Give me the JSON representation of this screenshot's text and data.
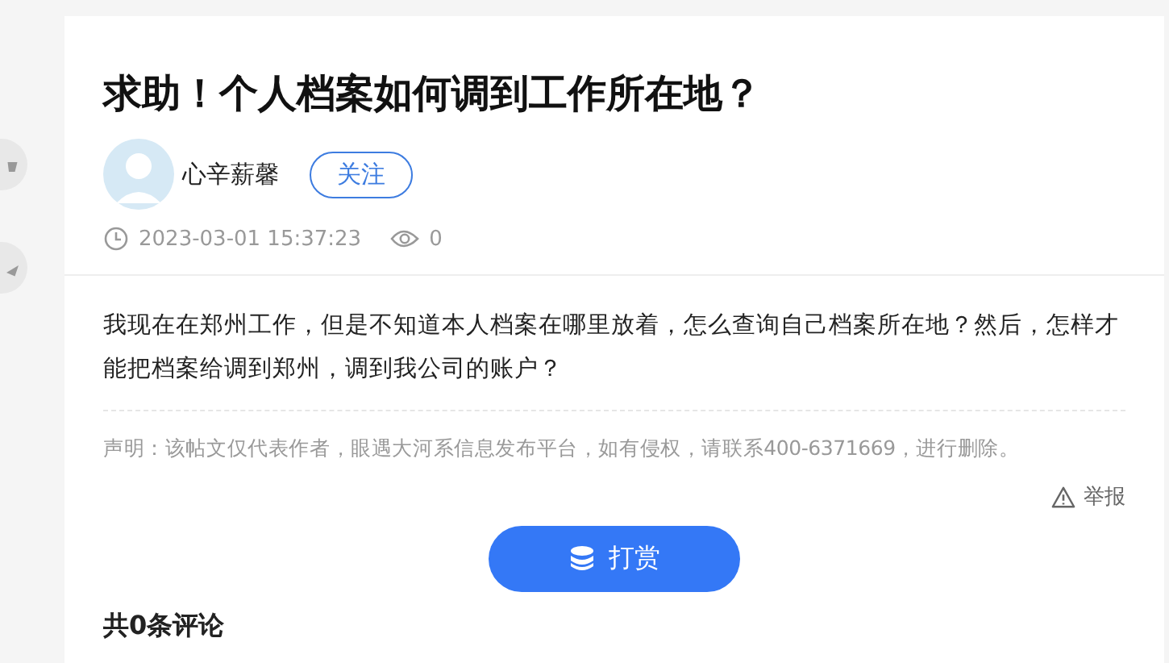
{
  "side_buttons": [
    {
      "kind": "like"
    },
    {
      "kind": "share"
    }
  ],
  "post": {
    "title": "求助！个人档案如何调到工作所在地？",
    "author": {
      "name": "心辛薪馨",
      "follow_label": "关注"
    },
    "time": "2023-03-01 15:37:23",
    "views": "0",
    "body": "我现在在郑州工作，但是不知道本人档案在哪里放着，怎么查询自己档案所在地？然后，怎样才能把档案给调到郑州，调到我公司的账户？",
    "statement": "声明：该帖文仅代表作者，眼遇大河系信息发布平台，如有侵权，请联系400-6371669，进行删除。",
    "report_label": "举报",
    "tip_label": "打赏"
  },
  "comments": {
    "heading": "共0条评论"
  }
}
